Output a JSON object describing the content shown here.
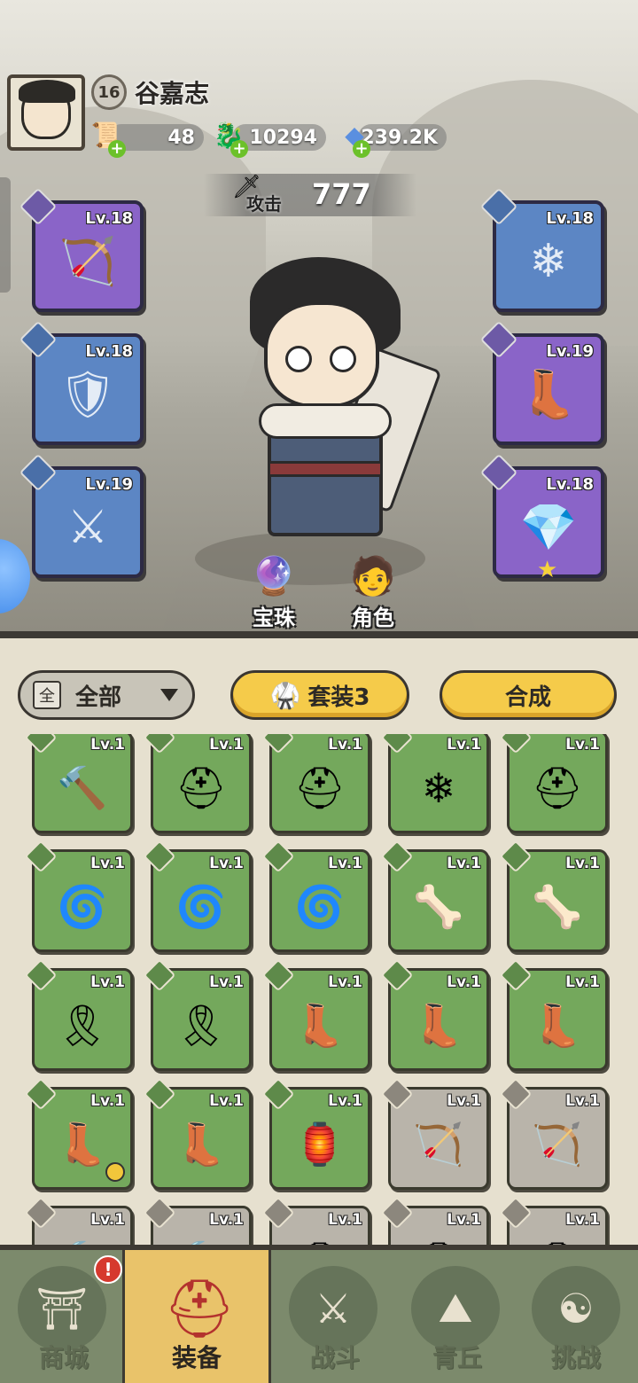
{
  "player": {
    "name": "谷嘉志",
    "level": "16"
  },
  "resources": [
    {
      "icon": "scroll-ticket-icon",
      "value": "48"
    },
    {
      "icon": "jade-dragon-icon",
      "value": "10294"
    },
    {
      "icon": "blue-crystal-icon",
      "value": "239.2K"
    }
  ],
  "attack": {
    "label": "攻击",
    "value": "777"
  },
  "equipped_left": [
    {
      "icon": "bow-icon",
      "level": "Lv.18",
      "rarity": "purple"
    },
    {
      "icon": "chest-armor-icon",
      "level": "Lv.18",
      "rarity": "blue"
    },
    {
      "icon": "shoulder-pads-icon",
      "level": "Lv.19",
      "rarity": "blue"
    }
  ],
  "equipped_right": [
    {
      "icon": "belt-icon",
      "level": "Lv.18",
      "rarity": "blue"
    },
    {
      "icon": "boots-icon",
      "level": "Lv.19",
      "rarity": "purple"
    },
    {
      "icon": "amulet-icon",
      "level": "Lv.18",
      "rarity": "purple"
    }
  ],
  "scene_buttons": {
    "orbs": "宝珠",
    "character": "角色"
  },
  "filters": {
    "all_icon": "全",
    "all_label": "全部",
    "set_label": "套装3",
    "craft_label": "合成"
  },
  "inventory": [
    {
      "level": "Lv.1",
      "rarity": "green",
      "icon": "hammer-icon"
    },
    {
      "level": "Lv.1",
      "rarity": "green",
      "icon": "red-helmet-icon"
    },
    {
      "level": "Lv.1",
      "rarity": "green",
      "icon": "red-helmet-icon"
    },
    {
      "level": "Lv.1",
      "rarity": "green",
      "icon": "frost-helmet-icon"
    },
    {
      "level": "Lv.1",
      "rarity": "green",
      "icon": "dark-helmet-icon"
    },
    {
      "level": "Lv.1",
      "rarity": "green",
      "icon": "red-shoulder-icon"
    },
    {
      "level": "Lv.1",
      "rarity": "green",
      "icon": "red-shoulder-icon"
    },
    {
      "level": "Lv.1",
      "rarity": "green",
      "icon": "dark-shoulder-icon"
    },
    {
      "level": "Lv.1",
      "rarity": "green",
      "icon": "bone-shoulder-icon"
    },
    {
      "level": "Lv.1",
      "rarity": "green",
      "icon": "bone-shoulder-icon"
    },
    {
      "level": "Lv.1",
      "rarity": "green",
      "icon": "red-belt-icon"
    },
    {
      "level": "Lv.1",
      "rarity": "green",
      "icon": "red-belt-icon"
    },
    {
      "level": "Lv.1",
      "rarity": "green",
      "icon": "red-boots-icon"
    },
    {
      "level": "Lv.1",
      "rarity": "green",
      "icon": "red-boots-icon"
    },
    {
      "level": "Lv.1",
      "rarity": "green",
      "icon": "frost-boots-icon"
    },
    {
      "level": "Lv.1",
      "rarity": "green",
      "icon": "dark-boots-icon"
    },
    {
      "level": "Lv.1",
      "rarity": "green",
      "icon": "bone-boots-icon"
    },
    {
      "level": "Lv.1",
      "rarity": "green",
      "icon": "red-amulet-icon"
    },
    {
      "level": "Lv.1",
      "rarity": "gray",
      "icon": "bow-icon"
    },
    {
      "level": "Lv.1",
      "rarity": "gray",
      "icon": "bow-icon"
    },
    {
      "level": "Lv.1",
      "rarity": "gray",
      "icon": "hammer-icon"
    },
    {
      "level": "Lv.1",
      "rarity": "gray",
      "icon": "hammer-icon"
    },
    {
      "level": "Lv.1",
      "rarity": "gray",
      "icon": "helmet-icon"
    },
    {
      "level": "Lv.1",
      "rarity": "gray",
      "icon": "helmet-icon"
    },
    {
      "level": "Lv.1",
      "rarity": "gray",
      "icon": "helmet-icon"
    }
  ],
  "nav": [
    {
      "label": "商城",
      "icon": "shop-icon",
      "alert": "!"
    },
    {
      "label": "装备",
      "icon": "equipment-icon"
    },
    {
      "label": "战斗",
      "icon": "crossed-swords-icon"
    },
    {
      "label": "青丘",
      "icon": "mountain-icon"
    },
    {
      "label": "挑战",
      "icon": "challenge-orb-icon"
    }
  ],
  "colors": {
    "purple_slot": "#8a64c8",
    "blue_slot": "#5c86c4",
    "green_slot": "#74a85c",
    "gray_slot": "#b9b4aa",
    "gold_button": "#f5cb4a",
    "nav_active": "#e9c36a"
  }
}
